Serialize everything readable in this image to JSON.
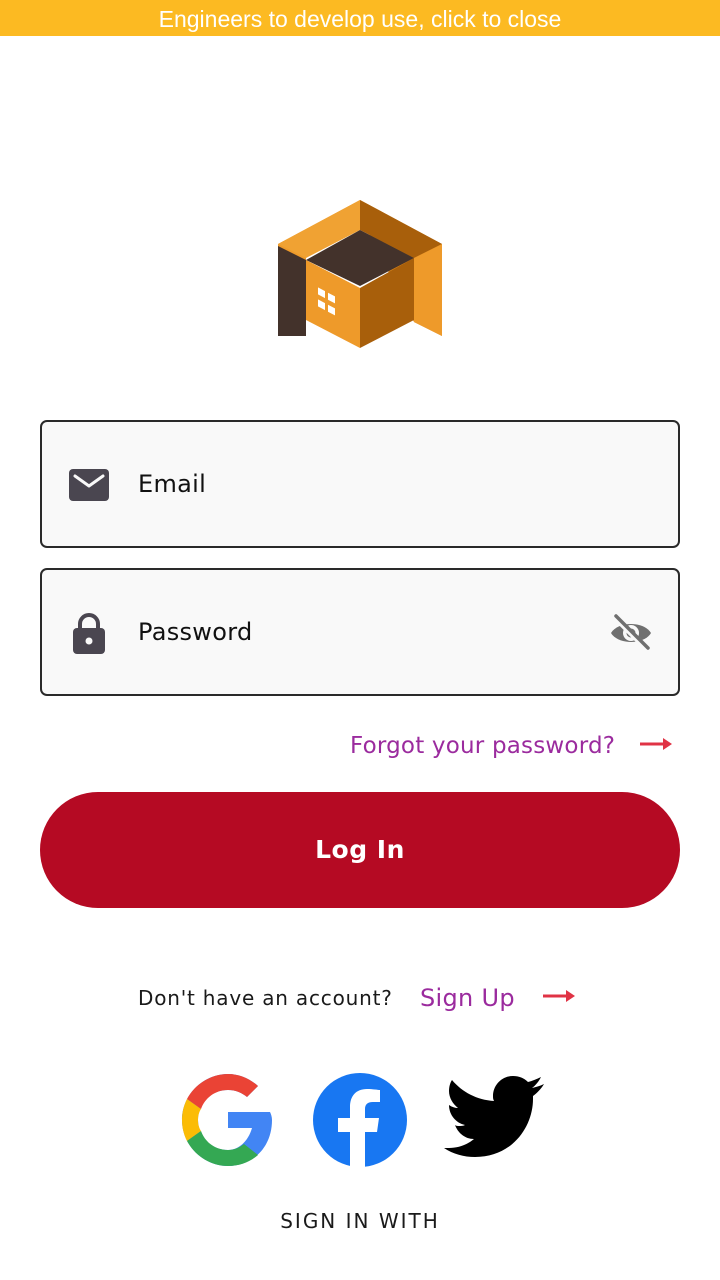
{
  "banner": {
    "text": "Engineers to develop use, click to close"
  },
  "login_form": {
    "email": {
      "placeholder": "Email",
      "icon": "mail-icon"
    },
    "password": {
      "placeholder": "Password",
      "icon": "lock-icon",
      "toggle_icon": "eye-off-icon"
    },
    "forgot_link": "Forgot your password?",
    "login_button": "Log In"
  },
  "signup": {
    "prompt": "Don't have an account?",
    "link": "Sign Up"
  },
  "social": {
    "heading": "SIGN IN WITH",
    "providers": [
      "google",
      "facebook",
      "twitter"
    ]
  },
  "colors": {
    "banner": "#fcba22",
    "primary": "#b50a23",
    "link": "#9b2b9e",
    "arrow": "#e03345",
    "logo_orange": "#ee9a2a",
    "logo_dark": "#43322b"
  }
}
